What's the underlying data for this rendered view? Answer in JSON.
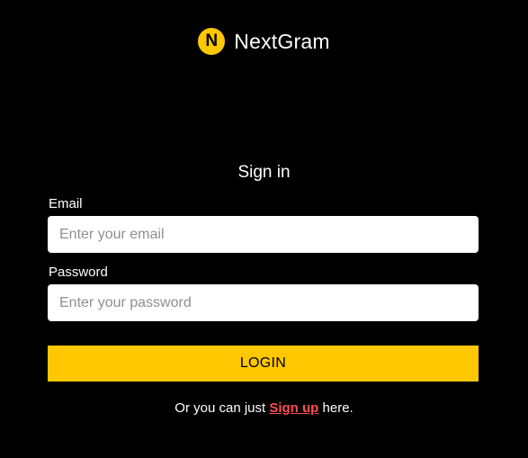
{
  "brand": {
    "logo_letter": "N",
    "name": "NextGram",
    "logo_color": "#ffc700"
  },
  "form": {
    "title": "Sign in",
    "email": {
      "label": "Email",
      "value": "",
      "placeholder": "Enter your email"
    },
    "password": {
      "label": "Password",
      "value": "",
      "placeholder": "Enter your password"
    },
    "submit_label": "LOGIN",
    "button_color": "#ffc700"
  },
  "footer": {
    "prefix": "Or you can just ",
    "link_label": "Sign up",
    "suffix": " here.",
    "link_color": "#ff4d4d"
  }
}
